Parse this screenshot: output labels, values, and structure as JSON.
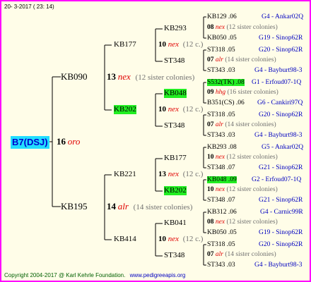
{
  "header": {
    "date": "20-  3-2017 ( 23: 14)"
  },
  "root": {
    "label": "B7(DSJ)",
    "num": "16",
    "race": "oro"
  },
  "gen1": [
    {
      "label": "KB090",
      "num": "13",
      "race": "nex",
      "note": "(12 sister colonies)"
    },
    {
      "label": "KB195",
      "num": "14",
      "race": "alr",
      "note": "(14 sister colonies)"
    }
  ],
  "gen2": [
    {
      "label": "KB177",
      "num": "10",
      "race": "nex",
      "note": "(12 c.)"
    },
    {
      "label": "KB202",
      "num": "10",
      "race": "nex",
      "note": "(12 c.)"
    },
    {
      "label": "KB221",
      "num": "13",
      "race": "nex",
      "note": "(12 c.)"
    },
    {
      "label": "KB414",
      "num": "10",
      "race": "nex",
      "note": "(12 c.)"
    }
  ],
  "gen3": [
    {
      "label": "KB293",
      "num": "08",
      "race": "nex",
      "note": "(12 sister colonies)"
    },
    {
      "label": "ST348",
      "num": "07",
      "race": "alr",
      "note": "(14 sister colonies)"
    },
    {
      "label": "KB048",
      "num": "09",
      "race": "hhg",
      "note": "(16 sister colonies)"
    },
    {
      "label": "ST348",
      "num": "07",
      "race": "alr",
      "note": "(14 sister colonies)"
    },
    {
      "label": "KB177",
      "num": "10",
      "race": "nex",
      "note": "(12 sister colonies)"
    },
    {
      "label": "KB202",
      "num": "10",
      "race": "nex",
      "note": "(12 sister colonies)"
    },
    {
      "label": "KB041",
      "num": "08",
      "race": "nex",
      "note": "(12 sister colonies)"
    },
    {
      "label": "ST348",
      "num": "07",
      "race": "alr",
      "note": "(14 sister colonies)"
    }
  ],
  "gen4": [
    {
      "name": "KB129",
      "year": ".06",
      "place": "G4 - Ankar02Q"
    },
    {
      "name": "KB050",
      "year": ".05",
      "place": "G19 - Sinop62R"
    },
    {
      "name": "ST318",
      "year": ".05",
      "place": "G20 - Sinop62R"
    },
    {
      "name": "ST343",
      "year": ".03",
      "place": "G4 - Bayburt98-3"
    },
    {
      "name": "S532(TK)",
      "year": ".08",
      "place": "G1 - Erfoud07-1Q"
    },
    {
      "name": "B351(CS)",
      "year": ".06",
      "place": "G6 - Cankiri97Q"
    },
    {
      "name": "ST318",
      "year": ".05",
      "place": "G20 - Sinop62R"
    },
    {
      "name": "ST343",
      "year": ".03",
      "place": "G4 - Bayburt98-3"
    },
    {
      "name": "KB293",
      "year": ".08",
      "place": "G5 - Ankar02Q"
    },
    {
      "name": "ST348",
      "year": ".07",
      "place": "G21 - Sinop62R"
    },
    {
      "name": "KB048",
      "year": ".09",
      "place": "G2 - Erfoud07-1Q"
    },
    {
      "name": "ST348",
      "year": ".07",
      "place": "G21 - Sinop62R"
    },
    {
      "name": "KB312",
      "year": ".06",
      "place": "G4 - Carnic99R"
    },
    {
      "name": "KB050",
      "year": ".05",
      "place": "G19 - Sinop62R"
    },
    {
      "name": "ST318",
      "year": ".05",
      "place": "G20 - Sinop62R"
    },
    {
      "name": "ST343",
      "year": ".03",
      "place": "G4 - Bayburt98-3"
    }
  ],
  "footer": {
    "copyright": "Copyright 2004-2017 @ Karl Kehrle Foundation.",
    "url": "www.pedigreeapis.org"
  }
}
